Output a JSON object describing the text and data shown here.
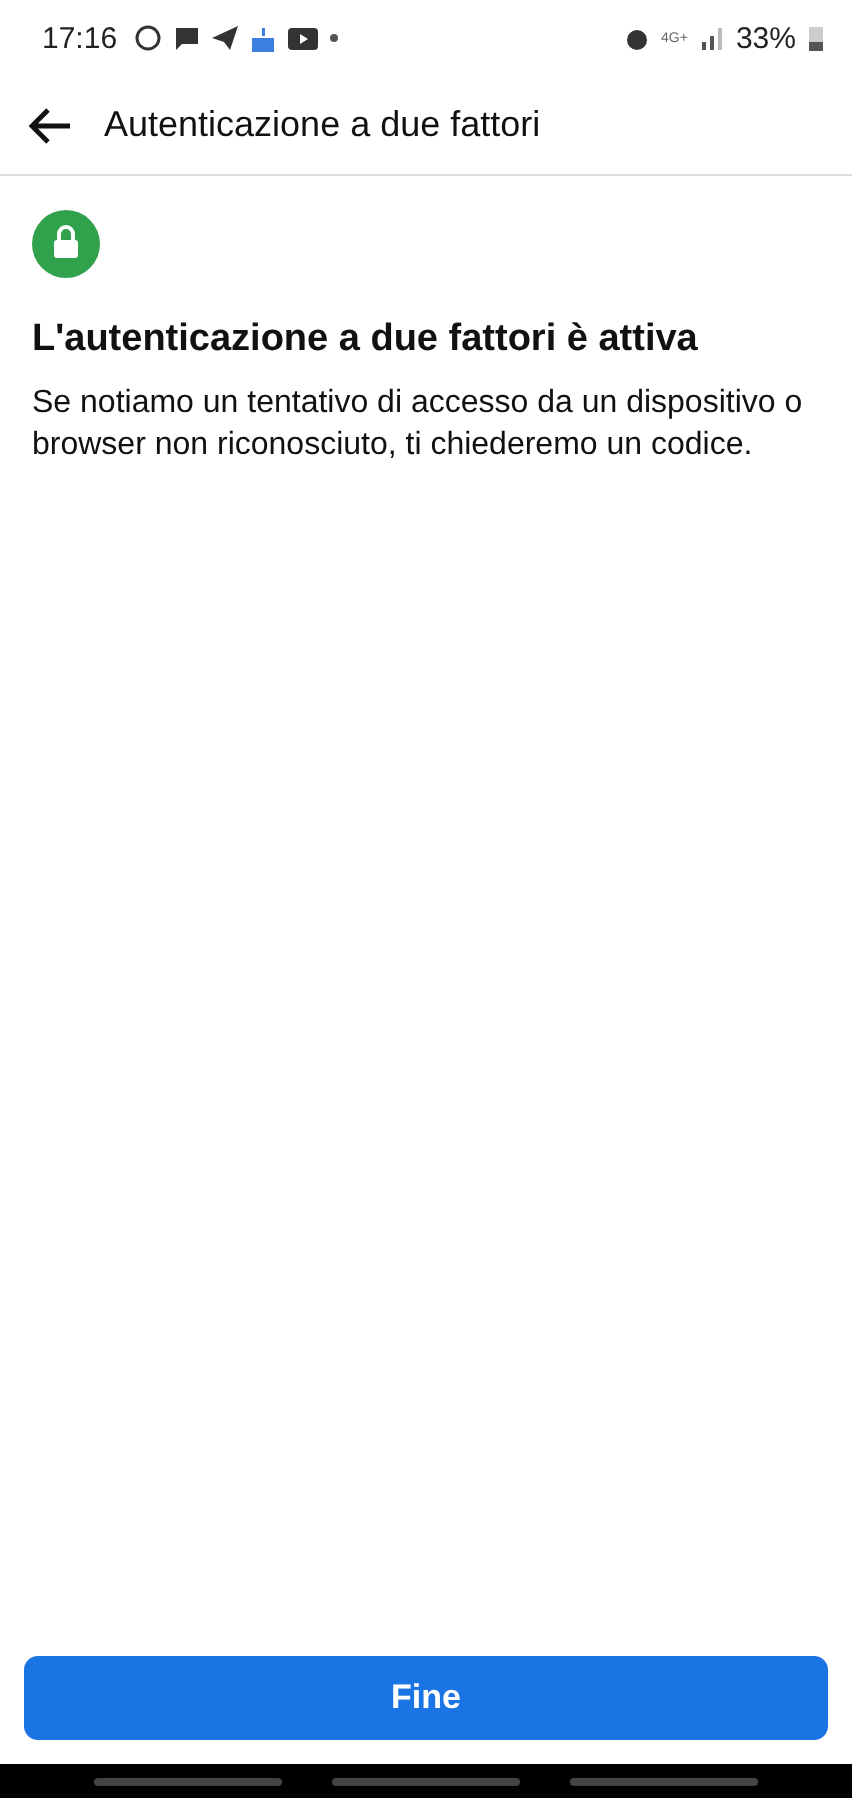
{
  "status_bar": {
    "time": "17:16",
    "network": "4G+",
    "battery": "33%"
  },
  "header": {
    "title": "Autenticazione a due fattori"
  },
  "content": {
    "title": "L'autenticazione a due fattori è attiva",
    "description": "Se notiamo un tentativo di accesso da un dispositivo o browser non riconosciuto, ti chiederemo un codice."
  },
  "buttons": [
    "Fine"
  ]
}
